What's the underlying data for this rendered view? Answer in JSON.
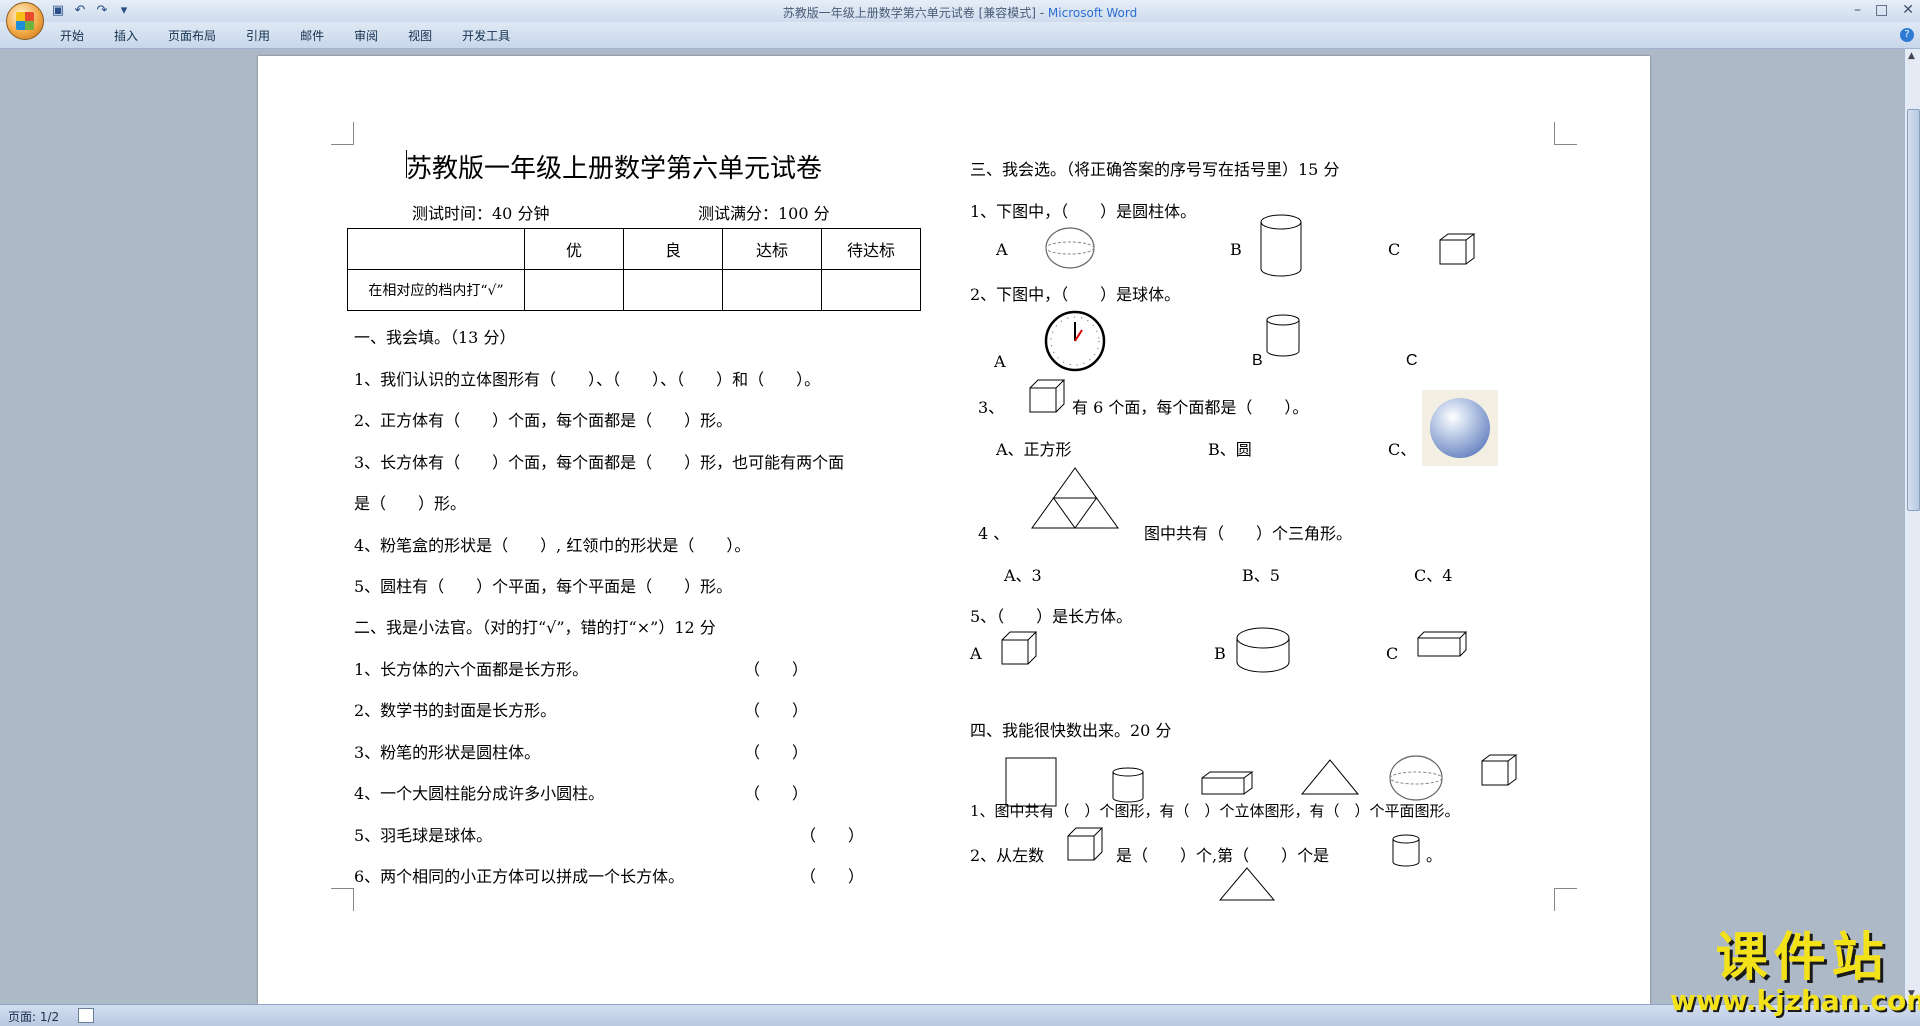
{
  "window": {
    "title": "苏教版一年级上册数学第六单元试卷 [兼容模式] - ",
    "app_name": "Microsoft Word"
  },
  "ribbon": {
    "tabs": [
      "开始",
      "插入",
      "页面布局",
      "引用",
      "邮件",
      "审阅",
      "视图",
      "开发工具"
    ]
  },
  "doc": {
    "title": "苏教版一年级上册数学第六单元试卷",
    "time_label": "测试时间：40 分钟",
    "score_label": "测试满分：100 分",
    "grade_table": {
      "headers": [
        "",
        "优",
        "良",
        "达标",
        "待达标"
      ],
      "row_label": "在相对应的档内打“√”"
    },
    "left": {
      "sec1_title": "一、我会填。（13 分）",
      "q1_1": "1、我们认识的立体图形有（　　）、（　　）、（　　）和（　　）。",
      "q1_2": "2、正方体有（　　）个面，每个面都是（　　）形。",
      "q1_3": "3、长方体有（　　）个面，每个面都是（　　）形，也可能有两个面",
      "q1_3b": "是（　　）形。",
      "q1_4": "4、粉笔盒的形状是（　　）, 红领巾的形状是（　　）。",
      "q1_5": "5、圆柱有（　　）个平面，每个平面是（　　）形。",
      "sec2_title": "二、我是小法官。（对的打“√”，错的打“×”）12 分",
      "q2_1": "1、长方体的六个面都是长方形。",
      "q2_2": "2、数学书的封面是长方形。",
      "q2_3": "3、粉笔的形状是圆柱体。",
      "q2_4": "4、一个大圆柱能分成许多小圆柱。",
      "q2_5": "5、羽毛球是球体。",
      "q2_6": "6、两个相同的小正方体可以拼成一个长方体。",
      "paren": "（　　）"
    },
    "right": {
      "sec3_title": "三、我会选。（将正确答案的序号写在括号里）15 分",
      "q3_1": "1、下图中，（　　）是圆柱体。",
      "q3_2": "2、下图中，（　　）是球体。",
      "q3_3_num": "3、",
      "q3_3": "有 6 个面，每个面都是（　　）。",
      "q3_3_opts": [
        "A、正方形",
        "B、圆",
        "C、"
      ],
      "q3_4_num": "4 、",
      "q3_4": "图中共有（　　）个三角形。",
      "q3_4_opts": [
        "A、3",
        "B、5",
        "C、4"
      ],
      "q3_5": "5、（　　）是长方体。",
      "opt_a": "A",
      "opt_b": "B",
      "opt_c": "C",
      "sec4_title": "四、我能很快数出来。20 分",
      "q4_1": "1、图中共有（　）个图形，有（　）个立体图形，有（　）个平面图形。",
      "q4_2a": "2、从左数",
      "q4_2b": "是（　　）个,第（　　）个是",
      "q4_2c": "。"
    }
  },
  "status": {
    "page": "页面: 1/2"
  },
  "watermark": {
    "cn": "课件站",
    "url": "www.kjzhan.com"
  }
}
